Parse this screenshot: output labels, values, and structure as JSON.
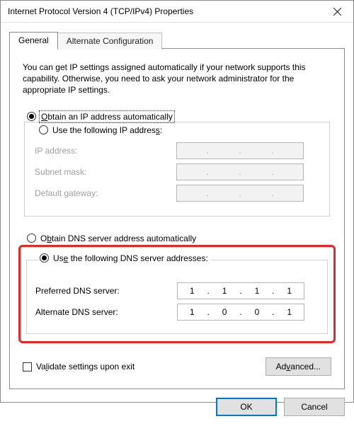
{
  "window": {
    "title": "Internet Protocol Version 4 (TCP/IPv4) Properties"
  },
  "tabs": {
    "general": "General",
    "alternate": "Alternate Configuration"
  },
  "intro": "You can get IP settings assigned automatically if your network supports this capability. Otherwise, you need to ask your network administrator for the appropriate IP settings.",
  "ip": {
    "auto_label_pre": "O",
    "auto_label_mid": "btain an IP address automatically",
    "manual_label_pre": "Use the following IP addres",
    "manual_label_u": "s",
    "manual_label_post": ":",
    "ip_label_u": "I",
    "ip_label_rest": "P address:",
    "mask_label_pre": "S",
    "mask_label_u": "u",
    "mask_label_post": "bnet mask:",
    "gw_label_u": "D",
    "gw_label_post": "efault gateway:"
  },
  "dns": {
    "auto_label_pre": "O",
    "auto_label_u": "b",
    "auto_label_post": "tain DNS server address automatically",
    "manual_label_pre": "Us",
    "manual_label_u": "e",
    "manual_label_post": " the following DNS server addresses:",
    "pref_label_u": "P",
    "pref_label_post": "referred DNS server:",
    "alt_label_u": "A",
    "alt_label_post": "lternate DNS server:",
    "preferred": [
      "1",
      "1",
      "1",
      "1"
    ],
    "alternate": [
      "1",
      "0",
      "0",
      "1"
    ]
  },
  "validate": {
    "label_pre": "Va",
    "label_u": "l",
    "label_post": "idate settings upon exit"
  },
  "buttons": {
    "advanced_pre": "Ad",
    "advanced_u": "v",
    "advanced_post": "anced...",
    "ok": "OK",
    "cancel": "Cancel"
  }
}
